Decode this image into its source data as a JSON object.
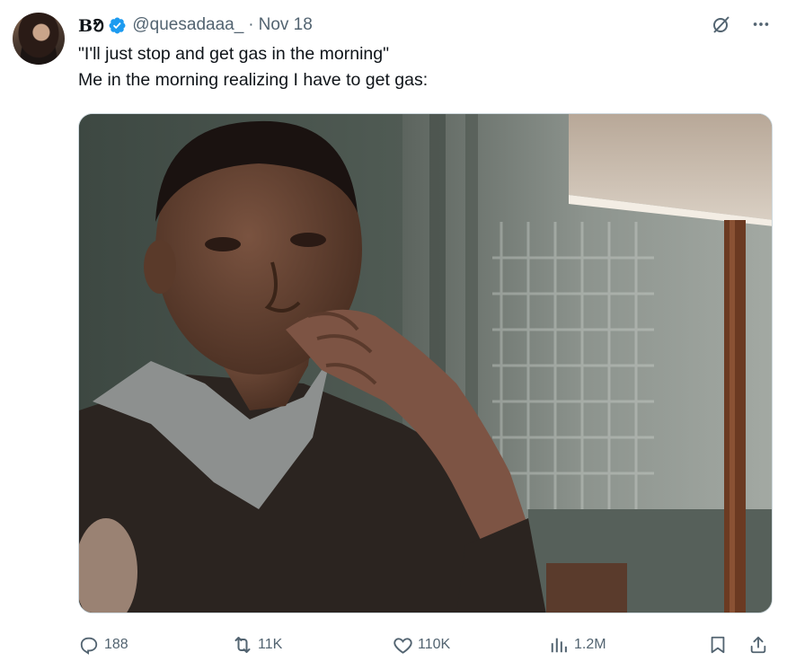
{
  "author": {
    "display_name": "Bᱚ",
    "handle": "@quesadaaa_",
    "separator": "·",
    "timestamp": "Nov 18",
    "verified": true
  },
  "tweet": {
    "lines": [
      "\"I'll just stop and get gas in the morning\"",
      "Me in the morning realizing I have to get gas:"
    ]
  },
  "media": {
    "description_icon": "photo-image"
  },
  "stats": {
    "replies": "188",
    "retweets": "11K",
    "likes": "110K",
    "views": "1.2M"
  },
  "icons": {
    "grok": "grok-icon",
    "more": "more-icon",
    "reply": "reply-icon",
    "retweet": "retweet-icon",
    "like": "heart-icon",
    "views": "views-icon",
    "bookmark": "bookmark-icon",
    "share": "share-icon"
  },
  "colors": {
    "text": "#0f1419",
    "secondary": "#536471",
    "verified": "#1d9bf0"
  }
}
